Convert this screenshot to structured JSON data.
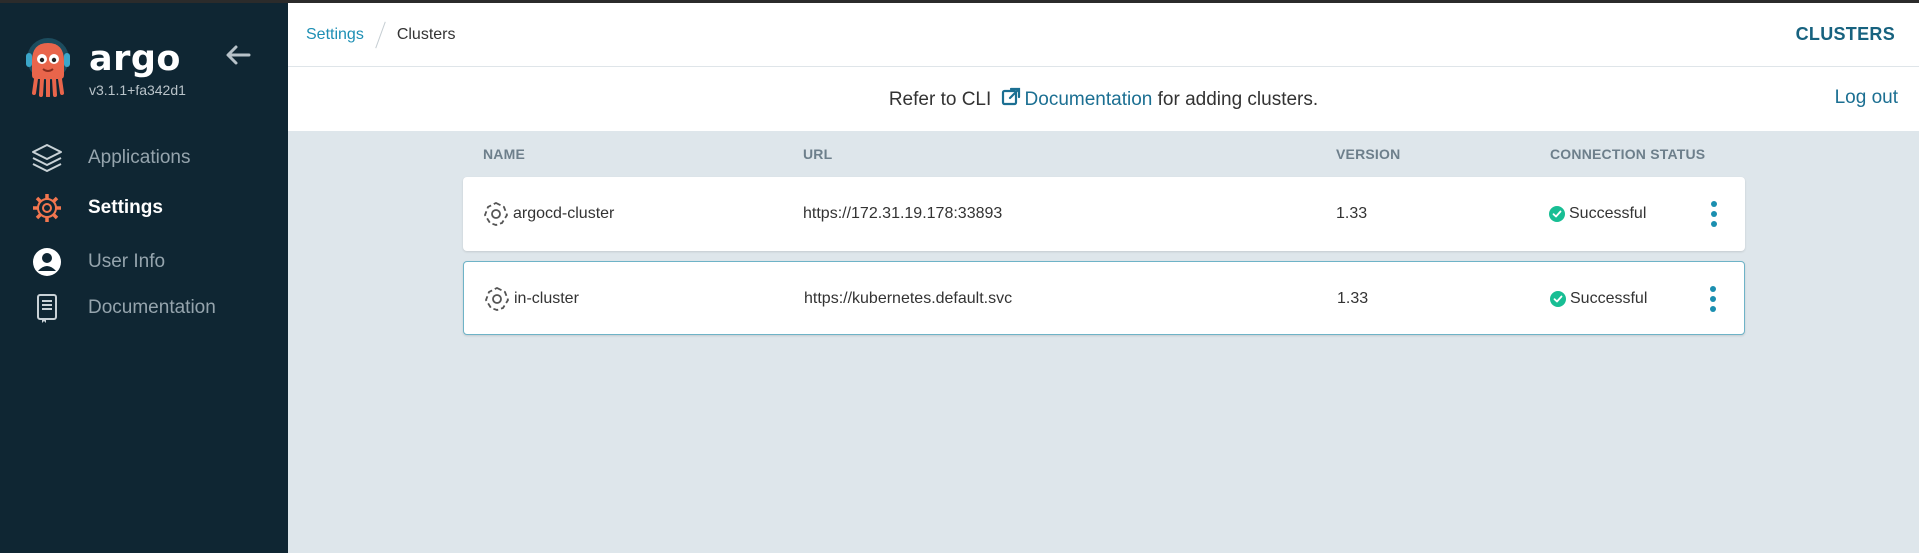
{
  "sidebar": {
    "brand": "argo",
    "version": "v3.1.1+fa342d1",
    "items": [
      {
        "label": "Applications",
        "icon": "layers-icon",
        "active": false
      },
      {
        "label": "Settings",
        "icon": "gear-icon",
        "active": true
      },
      {
        "label": "User Info",
        "icon": "user-circle-icon",
        "active": false
      },
      {
        "label": "Documentation",
        "icon": "book-icon",
        "active": false
      }
    ]
  },
  "header": {
    "breadcrumb": [
      "Settings",
      "Clusters"
    ],
    "title": "CLUSTERS"
  },
  "infobar": {
    "prefix": "Refer to CLI",
    "link": "Documentation",
    "suffix": "for adding clusters.",
    "logout": "Log out"
  },
  "table": {
    "columns": [
      "NAME",
      "URL",
      "VERSION",
      "CONNECTION STATUS"
    ],
    "rows": [
      {
        "name": "argocd-cluster",
        "url": "https://172.31.19.178:33893",
        "version": "1.33",
        "status": "Successful"
      },
      {
        "name": "in-cluster",
        "url": "https://kubernetes.default.svc",
        "version": "1.33",
        "status": "Successful"
      }
    ]
  },
  "colors": {
    "sidebar_bg": "#0f2633",
    "accent": "#1b6f92",
    "success": "#18be94",
    "settings_icon": "#f3764f"
  }
}
